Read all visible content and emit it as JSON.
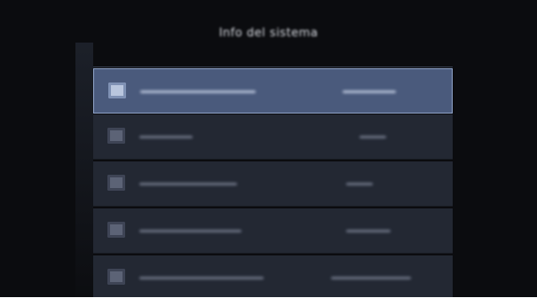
{
  "screen": {
    "title": "Info del sistema"
  },
  "section": {
    "header": ""
  },
  "list": {
    "items": [
      {
        "label": "",
        "value": "",
        "icon": "drive-icon",
        "selected": true
      },
      {
        "label": "",
        "value": "",
        "icon": "chip-icon",
        "selected": false
      },
      {
        "label": "",
        "value": "",
        "icon": "display-icon",
        "selected": false
      },
      {
        "label": "",
        "value": "",
        "icon": "network-icon",
        "selected": false
      },
      {
        "label": "",
        "value": "",
        "icon": "storage-icon",
        "selected": false
      }
    ]
  },
  "colors": {
    "background": "#0b0c0f",
    "row": "#232833",
    "selected_row": "#4a5a7c",
    "selected_border": "#8fa3c8"
  }
}
